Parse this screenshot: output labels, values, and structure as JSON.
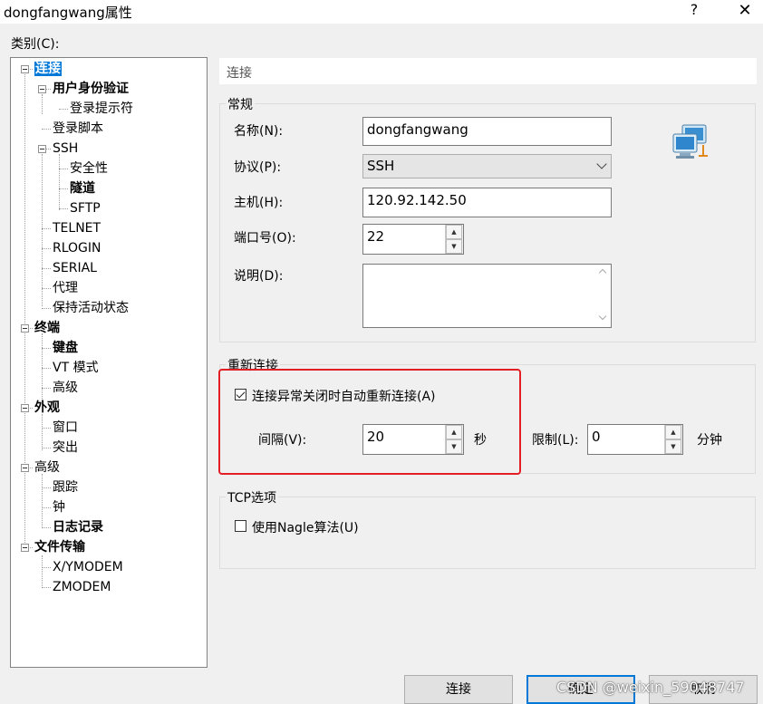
{
  "window": {
    "title": "dongfangwang属性",
    "help": "?",
    "close": "✕"
  },
  "category_label": "类别(C):",
  "tree": {
    "items": [
      {
        "label": "连接",
        "bold": true,
        "selected": true
      },
      {
        "label": "用户身份验证",
        "bold": true
      },
      {
        "label": "登录提示符"
      },
      {
        "label": "登录脚本"
      },
      {
        "label": "SSH"
      },
      {
        "label": "安全性"
      },
      {
        "label": "隧道",
        "bold": true
      },
      {
        "label": "SFTP"
      },
      {
        "label": "TELNET"
      },
      {
        "label": "RLOGIN"
      },
      {
        "label": "SERIAL"
      },
      {
        "label": "代理"
      },
      {
        "label": "保持活动状态"
      },
      {
        "label": "终端",
        "bold": true
      },
      {
        "label": "键盘",
        "bold": true
      },
      {
        "label": "VT 模式"
      },
      {
        "label": "高级"
      },
      {
        "label": "外观",
        "bold": true
      },
      {
        "label": "窗口"
      },
      {
        "label": "突出"
      },
      {
        "label": "高级"
      },
      {
        "label": "跟踪"
      },
      {
        "label": "钟"
      },
      {
        "label": "日志记录",
        "bold": true
      },
      {
        "label": "文件传输",
        "bold": true
      },
      {
        "label": "X/YMODEM"
      },
      {
        "label": "ZMODEM"
      }
    ]
  },
  "section_header": "连接",
  "general": {
    "group_label": "常规",
    "name_label": "名称(N):",
    "name_value": "dongfangwang",
    "protocol_label": "协议(P):",
    "protocol_value": "SSH",
    "host_label": "主机(H):",
    "host_value": "120.92.142.50",
    "port_label": "端口号(O):",
    "port_value": "22",
    "desc_label": "说明(D):",
    "desc_value": ""
  },
  "reconnect": {
    "group_label": "重新连接",
    "auto_label": "连接异常关闭时自动重新连接(A)",
    "auto_checked": true,
    "interval_label": "间隔(V):",
    "interval_value": "20",
    "interval_unit": "秒",
    "limit_label": "限制(L):",
    "limit_value": "0",
    "limit_unit": "分钟"
  },
  "tcp": {
    "group_label": "TCP选项",
    "nagle_label": "使用Nagle算法(U)",
    "nagle_checked": false
  },
  "buttons": {
    "connect": "连接",
    "ok": "确定",
    "cancel": "取消"
  },
  "watermark": "CSDN @weixin_59048747",
  "colors": {
    "selection": "#0078d7",
    "highlight_box": "#e31e24"
  }
}
